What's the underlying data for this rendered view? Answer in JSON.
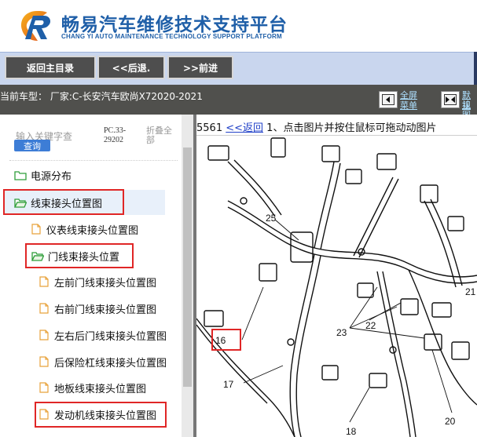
{
  "header": {
    "title": "畅易汽车维修技术支持平台",
    "subtitle": "CHANG YI AUTO MAINTENANCE TECHNOLOGY SUPPORT PLATFORM",
    "brand_color": "#1f5fa8"
  },
  "toolbar": {
    "home_label": "返回主目录",
    "back_label": "<<后退.",
    "forward_label": ">>前进"
  },
  "infobar": {
    "vehicle": "当前车型：  厂家:C-长安汽车欧尚X72020-2021",
    "fullscreen_label": "全屏",
    "menu_label": "菜单",
    "default_label": "默认",
    "view_label": "视图"
  },
  "sidebar": {
    "search_placeholder": "输入关键字查",
    "search_button": "查询",
    "pc_code_1": "PC.33-",
    "pc_code_2": "29202",
    "collapse_1": "折叠全",
    "collapse_2": "部",
    "items": [
      {
        "label": "电源分布",
        "icon": "folder-icon"
      },
      {
        "label": "线束接头位置图",
        "icon": "folder-open-icon"
      },
      {
        "label": "仪表线束接头位置图",
        "icon": "document-icon"
      },
      {
        "label": "门线束接头位置",
        "icon": "folder-open-icon"
      },
      {
        "label": "左前门线束接头位置图",
        "icon": "document-icon"
      },
      {
        "label": "右前门线束接头位置图",
        "icon": "document-icon"
      },
      {
        "label": "左右后门线束接头位置图",
        "icon": "document-icon"
      },
      {
        "label": "后保险杠线束接头位置图",
        "icon": "document-icon"
      },
      {
        "label": "地板线束接头位置图",
        "icon": "document-icon"
      },
      {
        "label": "发动机线束接头位置图",
        "icon": "document-icon"
      }
    ]
  },
  "content": {
    "page_no": "5561",
    "back_link": "<<返回",
    "instruction": "1、点击图片并按住鼠标可拖动动图片",
    "callouts": [
      "25",
      "23",
      "22",
      "16",
      "17",
      "18",
      "20",
      "21"
    ]
  },
  "colors": {
    "toolbar_bg": "#c9d6ee",
    "infobar_bg": "#50504d",
    "highlight": "#e02626",
    "link": "#2040c8"
  }
}
